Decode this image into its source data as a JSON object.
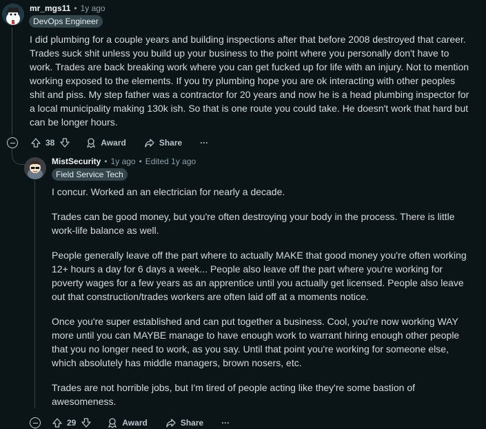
{
  "comment1": {
    "username": "mr_mgs11",
    "age": "1y ago",
    "flair": "DevOps Engineer",
    "paragraphs": [
      "I did plumbing for a couple years and building inspections after that before 2008 destroyed that career. Trades suck shit unless you build up your business to the point where you personally don't have to work. Trades are back breaking work where you can get fucked up for life with an injury. Not to mention working exposed to the elements. If you try plumbing hope you are ok interacting with other peoples shit and piss. My step father was a contractor for 20 years and now he is a head plumbing inspector for a local municipality making 130k ish. So that is one route you could take. He doesn't work that hard but can be longer hours."
    ],
    "votes": "38",
    "award_label": "Award",
    "share_label": "Share",
    "more_label": "···"
  },
  "comment2": {
    "username": "MistSecurity",
    "age": "1y ago",
    "edited": "Edited 1y ago",
    "flair": "Field Service Tech",
    "paragraphs": [
      "I concur. Worked an an electrician for nearly a decade.",
      "Trades can be good money, but you're often destroying your body in the process. There is little work-life balance as well.",
      "People generally leave off the part where to actually MAKE that good money you're often working 12+ hours a day for 6 days a week... People also leave off the part where you're working for poverty wages for a few years as an apprentice until you actually get licensed. People also leave out that construction/trades workers are often laid off at a moments notice.",
      "Once you're super established and can put together a business. Cool, you're now working WAY more until you can MAYBE manage to have enough work to warrant hiring enough other people that you no longer need to work, as you say. Until that point you're working for someone else, which absolutely has middle managers, brown nosers, etc.",
      "Trades are not horrible jobs, but I'm tired of people acting like they're some bastion of awesomeness."
    ],
    "votes": "29",
    "award_label": "Award",
    "share_label": "Share",
    "more_label": "···"
  },
  "separator": "•",
  "icons": [
    "avatar",
    "upvote-icon",
    "downvote-icon",
    "award-icon",
    "share-icon",
    "more-icon",
    "collapse-icon"
  ]
}
